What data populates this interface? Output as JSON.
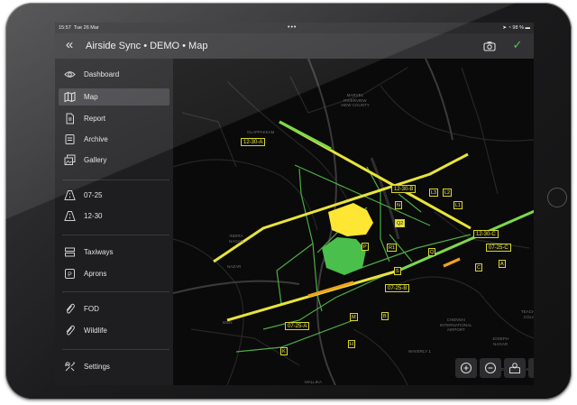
{
  "status_bar": {
    "time": "15:57",
    "date": "Tue 26 Mar",
    "dots": "•••",
    "battery": "98 %"
  },
  "nav": {
    "title": "Airside Sync • DEMO • Map",
    "back_icon": "chevrons-left-icon",
    "camera_icon": "camera-icon",
    "check_icon": "checkmark-icon"
  },
  "sidebar": {
    "groups": [
      [
        {
          "label": "Dashboard",
          "icon": "eye-icon"
        },
        {
          "label": "Map",
          "icon": "map-icon",
          "active": true
        },
        {
          "label": "Report",
          "icon": "report-icon"
        },
        {
          "label": "Archive",
          "icon": "archive-icon"
        },
        {
          "label": "Gallery",
          "icon": "gallery-icon"
        }
      ],
      [
        {
          "label": "07-25",
          "icon": "runway-icon"
        },
        {
          "label": "12-30",
          "icon": "runway-icon"
        }
      ],
      [
        {
          "label": "Taxiways",
          "icon": "taxiway-icon"
        },
        {
          "label": "Aprons",
          "icon": "apron-icon"
        }
      ],
      [
        {
          "label": "FOD",
          "icon": "paperclip-icon"
        },
        {
          "label": "Wildlife",
          "icon": "paperclip-icon"
        }
      ],
      [
        {
          "label": "Settings",
          "icon": "settings-icon"
        }
      ]
    ]
  },
  "map": {
    "runway_labels": [
      "12-30-A",
      "12-30-B",
      "12-30-C",
      "07-25-A",
      "07-25-B",
      "07-25-C"
    ],
    "taxiway_labels": [
      "N",
      "L3",
      "L2",
      "L1",
      "Q2",
      "P",
      "R1",
      "Q",
      "S",
      "J",
      "A",
      "C",
      "M",
      "B",
      "K",
      "H"
    ],
    "place_labels": [
      "MARVEL\nRIVERVIEW\nVIEW COUNTY",
      "OLAPPAKKAM",
      "INDIRA\nNAGAR",
      "NAZAR",
      "CHENNAI\nINTERNATIONAL\nAIRPORT",
      "TEACHERS\nCOLONY",
      "JOSEPH\nNAGAR",
      "WAVERLY 1",
      "VENUGOPALAPURAM",
      "MALLIKA",
      "IEEN"
    ],
    "controls": [
      {
        "icon": "zoom-in-icon"
      },
      {
        "icon": "zoom-out-icon"
      },
      {
        "icon": "map-layers-icon"
      },
      {
        "icon": "sliders-icon"
      }
    ],
    "colors": {
      "runway_yellow": "#e8e33b",
      "runway_green": "#7dd94a",
      "runway_orange": "#f0a21c",
      "apron_yellow": "#ffe633",
      "apron_green": "#4bbf4b",
      "taxiway": "#4dab45"
    }
  }
}
